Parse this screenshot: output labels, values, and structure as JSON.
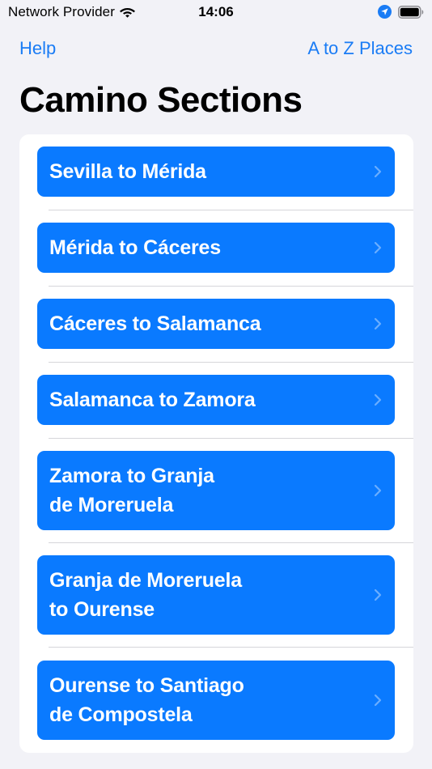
{
  "status_bar": {
    "carrier": "Network Provider",
    "time": "14:06"
  },
  "nav": {
    "left_label": "Help",
    "right_label": "A to Z Places"
  },
  "title": "Camino Sections",
  "sections": [
    {
      "line1": "Sevilla to Mérida",
      "line2": ""
    },
    {
      "line1": "Mérida to Cáceres",
      "line2": ""
    },
    {
      "line1": "Cáceres to Salamanca",
      "line2": ""
    },
    {
      "line1": "Salamanca to Zamora",
      "line2": ""
    },
    {
      "line1": "Zamora to Granja",
      "line2": "de Moreruela"
    },
    {
      "line1": "Granja de Moreruela",
      "line2": "to Ourense"
    },
    {
      "line1": "Ourense to Santiago",
      "line2": "de Compostela"
    }
  ],
  "colors": {
    "accent": "#1a7cf5",
    "button": "#0a7aff",
    "background": "#f2f2f7"
  },
  "icons": {
    "wifi": "wifi-icon",
    "location": "location-arrow-icon",
    "battery": "battery-icon",
    "chevron": "chevron-right-icon"
  }
}
